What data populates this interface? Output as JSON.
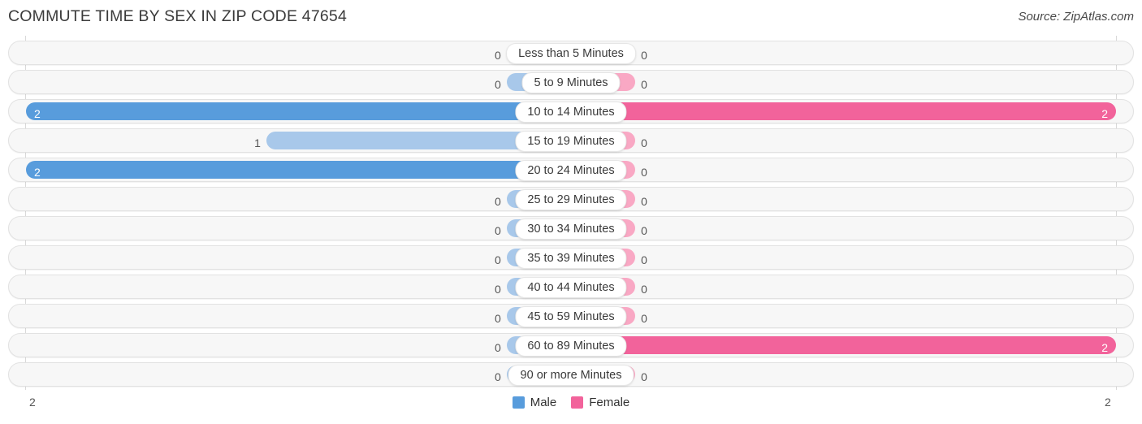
{
  "header": {
    "title": "COMMUTE TIME BY SEX IN ZIP CODE 47654",
    "source": "Source: ZipAtlas.com"
  },
  "legend": {
    "items": [
      {
        "label": "Male",
        "color": "#589cdc",
        "swatch_icon": "square-swatch-icon"
      },
      {
        "label": "Female",
        "color": "#f2639b",
        "swatch_icon": "square-swatch-icon"
      }
    ]
  },
  "axis": {
    "left_max_label": "2",
    "right_max_label": "2"
  },
  "colors": {
    "male_low": "#a8c8ea",
    "male_high": "#589cdc",
    "female_low": "#f9a8c4",
    "female_high": "#f2639b",
    "row_track": "#f7f7f7",
    "row_border": "#e2e2e2",
    "gridline": "#d9d9d9"
  },
  "chart_data": {
    "type": "bar",
    "subtype": "diverging-horizontal",
    "title": "COMMUTE TIME BY SEX IN ZIP CODE 47654",
    "xlabel": "",
    "ylabel": "",
    "xlim": [
      2,
      2
    ],
    "axis_max": 2,
    "grid": true,
    "legend_position": "bottom-center",
    "categories": [
      "Less than 5 Minutes",
      "5 to 9 Minutes",
      "10 to 14 Minutes",
      "15 to 19 Minutes",
      "20 to 24 Minutes",
      "25 to 29 Minutes",
      "30 to 34 Minutes",
      "35 to 39 Minutes",
      "40 to 44 Minutes",
      "45 to 59 Minutes",
      "60 to 89 Minutes",
      "90 or more Minutes"
    ],
    "series": [
      {
        "name": "Male",
        "side": "left",
        "color": "#589cdc",
        "values": [
          0,
          0,
          2,
          1,
          2,
          0,
          0,
          0,
          0,
          0,
          0,
          0
        ],
        "value_labels": [
          "0",
          "0",
          "2",
          "1",
          "2",
          "0",
          "0",
          "0",
          "0",
          "0",
          "0",
          "0"
        ]
      },
      {
        "name": "Female",
        "side": "right",
        "color": "#f2639b",
        "values": [
          0,
          0,
          2,
          0,
          0,
          0,
          0,
          0,
          0,
          0,
          2,
          0
        ],
        "value_labels": [
          "0",
          "0",
          "2",
          "0",
          "0",
          "0",
          "0",
          "0",
          "0",
          "0",
          "2",
          "0"
        ]
      }
    ]
  }
}
